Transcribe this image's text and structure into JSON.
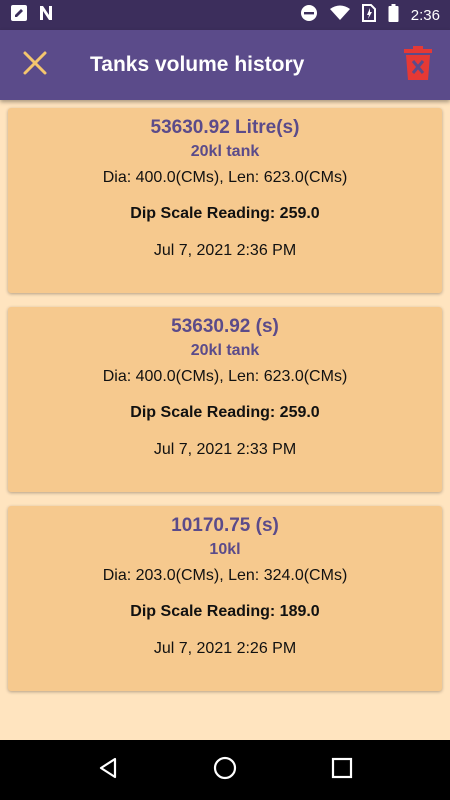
{
  "status_bar": {
    "time": "2:36",
    "icons": [
      "edit-square-icon",
      "n-notification-icon",
      "do-not-disturb-icon",
      "wifi-icon",
      "sim-icon",
      "battery-icon"
    ]
  },
  "app_bar": {
    "title": "Tanks volume history",
    "close_icon": "close-icon",
    "delete_icon": "delete-icon"
  },
  "colors": {
    "status_bar": "#3c2e5c",
    "app_bar": "#5b4b8a",
    "background": "#ffe4bf",
    "card": "#f6c98e",
    "accent_text": "#5b4b8a",
    "close_icon": "#f5c66e",
    "delete_icon": "#e53935"
  },
  "history": [
    {
      "volume": "53630.92  Litre(s)",
      "tank_name": "20kl tank",
      "dimensions": "Dia: 400.0(CMs), Len: 623.0(CMs)",
      "dip_reading": "Dip Scale Reading: 259.0",
      "date": "Jul 7, 2021 2:36 PM"
    },
    {
      "volume": "53630.92  (s)",
      "tank_name": "20kl tank",
      "dimensions": "Dia: 400.0(CMs), Len: 623.0(CMs)",
      "dip_reading": "Dip Scale Reading: 259.0",
      "date": "Jul 7, 2021 2:33 PM"
    },
    {
      "volume": "10170.75  (s)",
      "tank_name": "10kl",
      "dimensions": "Dia: 203.0(CMs), Len: 324.0(CMs)",
      "dip_reading": "Dip Scale Reading: 189.0",
      "date": "Jul 7, 2021 2:26 PM"
    }
  ],
  "nav_bar": {
    "buttons": [
      "back-icon",
      "home-icon",
      "recents-icon"
    ]
  }
}
